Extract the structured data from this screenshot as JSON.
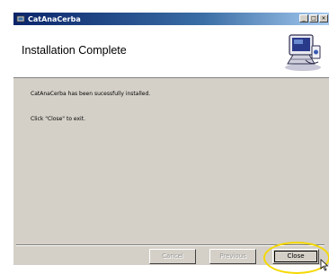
{
  "window": {
    "title": "CatAnaCerba",
    "controls": {
      "minimize": "_",
      "maximize": "□",
      "close": "×"
    }
  },
  "header": {
    "title": "Installation Complete",
    "image": "computer-setup-icon"
  },
  "content": {
    "message1": "CatAnaCerba has been sucessfully installed.",
    "message2": "Click \"Close\" to exit."
  },
  "buttons": {
    "cancel": "Cancel",
    "previous": "Previous",
    "close": "Close"
  },
  "colors": {
    "window_bg": "#d4d0c8",
    "titlebar_start": "#0a246a",
    "highlight": "#f5d800"
  }
}
